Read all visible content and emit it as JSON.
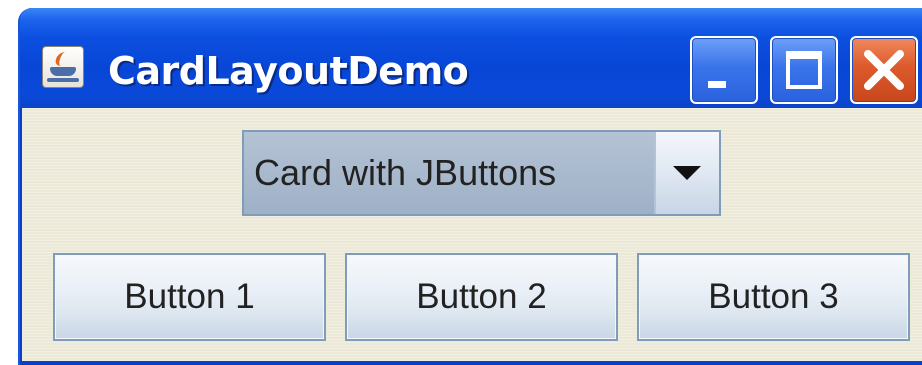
{
  "window": {
    "title": "CardLayoutDemo",
    "icon": "java-coffee-cup-icon",
    "controls": {
      "minimize_icon": "minimize-icon",
      "maximize_icon": "maximize-icon",
      "close_icon": "close-icon"
    }
  },
  "combo": {
    "selected": "Card with JButtons",
    "arrow_icon": "chevron-down-icon"
  },
  "card": {
    "buttons": [
      "Button 1",
      "Button 2",
      "Button 3"
    ]
  },
  "colors": {
    "titlebar": "#0a49d9",
    "close_button": "#dc5a2c",
    "content_background": "#ece9d8",
    "button_border": "#7f9db9"
  }
}
